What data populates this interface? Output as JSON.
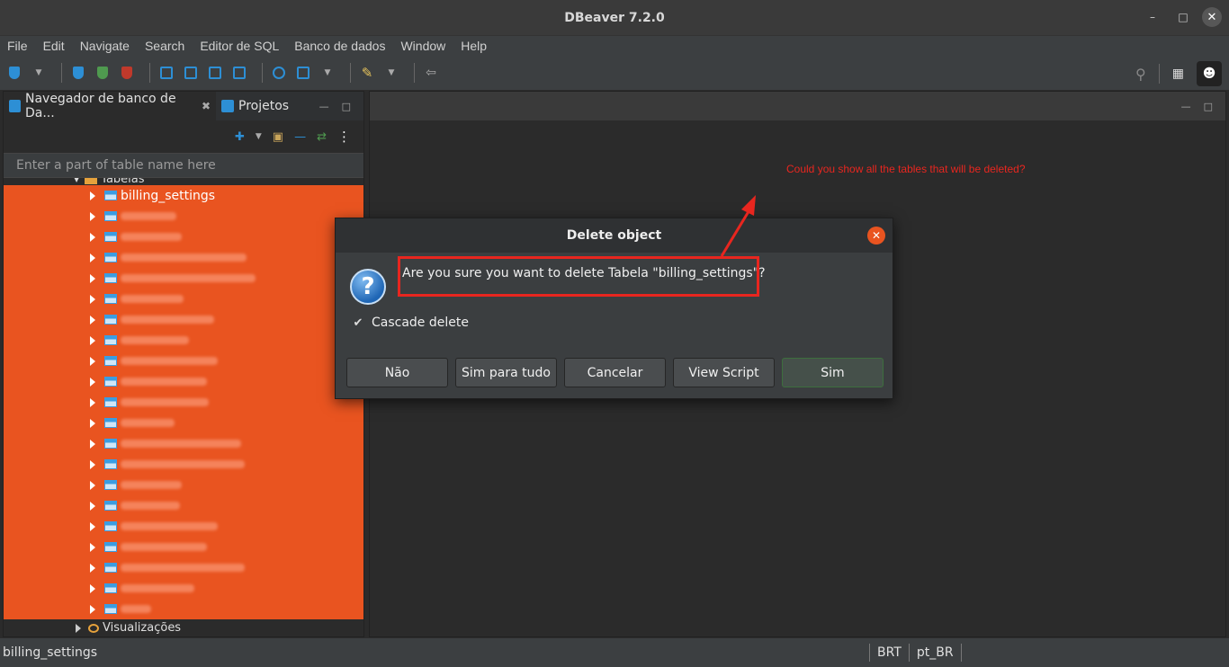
{
  "window": {
    "title": "DBeaver 7.2.0"
  },
  "menu": [
    "File",
    "Edit",
    "Navigate",
    "Search",
    "Editor de SQL",
    "Banco de dados",
    "Window",
    "Help"
  ],
  "left_panel": {
    "tabs": [
      {
        "label": "Navegador de banco de Da..."
      },
      {
        "label": "Projetos"
      }
    ],
    "filter_placeholder": "Enter a part of table name here",
    "folder_label": "Tabelas",
    "selected_table": "billing_settings",
    "blurred_rows": [
      62,
      68,
      140,
      150,
      70,
      104,
      76,
      108,
      96,
      98,
      60,
      134,
      138,
      68,
      66,
      108,
      96,
      138,
      82,
      34
    ],
    "views_label": "Visualizações"
  },
  "annotation": {
    "text": "Could you show all the tables that will be deleted?",
    "color": "#e8261f"
  },
  "dialog": {
    "title": "Delete object",
    "message": "Are you sure you want to delete Tabela \"billing_settings\"?",
    "checkbox_label": "Cascade delete",
    "checkbox_checked": true,
    "buttons": {
      "no": "Não",
      "yes_all": "Sim para tudo",
      "cancel": "Cancelar",
      "view_script": "View Script",
      "yes": "Sim"
    }
  },
  "statusbar": {
    "selection": "billing_settings",
    "timezone": "BRT",
    "locale": "pt_BR"
  },
  "colors": {
    "selection": "#e95420",
    "accent": "#2d8fd5",
    "annotation": "#e8261f"
  }
}
